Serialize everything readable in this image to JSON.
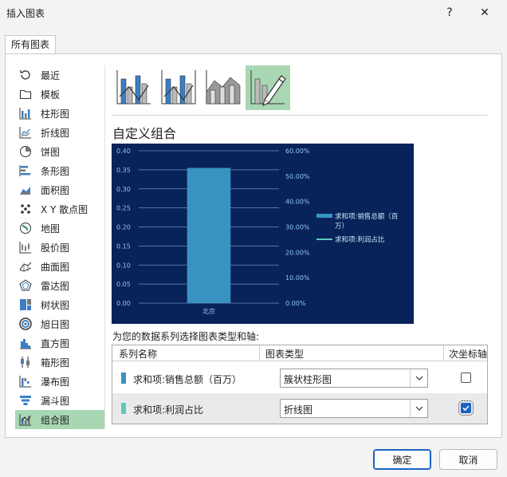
{
  "window": {
    "title": "插入图表",
    "help_label": "?",
    "close_label": "✕"
  },
  "tabs": [
    {
      "label": "所有图表"
    }
  ],
  "sidebar": {
    "items": [
      {
        "label": "最近",
        "icon": "recent-icon"
      },
      {
        "label": "模板",
        "icon": "folder-icon"
      },
      {
        "label": "柱形图",
        "icon": "column-chart-icon"
      },
      {
        "label": "折线图",
        "icon": "line-chart-icon"
      },
      {
        "label": "饼图",
        "icon": "pie-chart-icon"
      },
      {
        "label": "条形图",
        "icon": "bar-chart-icon"
      },
      {
        "label": "面积图",
        "icon": "area-chart-icon"
      },
      {
        "label": "X Y 散点图",
        "icon": "scatter-chart-icon"
      },
      {
        "label": "地图",
        "icon": "map-chart-icon"
      },
      {
        "label": "股价图",
        "icon": "stock-chart-icon"
      },
      {
        "label": "曲面图",
        "icon": "surface-chart-icon"
      },
      {
        "label": "雷达图",
        "icon": "radar-chart-icon"
      },
      {
        "label": "树状图",
        "icon": "treemap-chart-icon"
      },
      {
        "label": "旭日图",
        "icon": "sunburst-chart-icon"
      },
      {
        "label": "直方图",
        "icon": "histogram-chart-icon"
      },
      {
        "label": "箱形图",
        "icon": "box-whisker-chart-icon"
      },
      {
        "label": "瀑布图",
        "icon": "waterfall-chart-icon"
      },
      {
        "label": "漏斗图",
        "icon": "funnel-chart-icon"
      },
      {
        "label": "组合图",
        "icon": "combo-chart-icon",
        "selected": true
      }
    ]
  },
  "subtypes": [
    {
      "icon": "clustered-column-line-icon",
      "selected": false
    },
    {
      "icon": "clustered-column-line-secondary-icon",
      "selected": false
    },
    {
      "icon": "stacked-area-column-icon",
      "selected": false
    },
    {
      "icon": "custom-combination-icon",
      "selected": true
    }
  ],
  "section_title": "自定义组合",
  "colors": {
    "accent": "#1a63c2",
    "selection": "#a9d7b3",
    "chart_background": "#08235a",
    "bar_series": "#3993c2",
    "line_series": "#5fc9b6"
  },
  "chart_data": {
    "type": "bar",
    "categories": [
      "北京"
    ],
    "series": [
      {
        "name": "求和项:销售总额（百万）",
        "type": "bar",
        "axis": "primary",
        "values": [
          0.355
        ]
      },
      {
        "name": "求和项:利润占比",
        "type": "line",
        "axis": "secondary",
        "values": [
          0.0
        ]
      }
    ],
    "primary_ylim": [
      0,
      0.4
    ],
    "primary_ticks": [
      "0.00",
      "0.05",
      "0.10",
      "0.15",
      "0.20",
      "0.25",
      "0.30",
      "0.35",
      "0.40"
    ],
    "secondary_ylim": [
      0,
      0.6
    ],
    "secondary_ticks": [
      "0.00%",
      "10.00%",
      "20.00%",
      "30.00%",
      "40.00%",
      "50.00%",
      "60.00%"
    ],
    "grid": true,
    "legend": "right"
  },
  "assignment_label": "为您的数据系列选择图表类型和轴:",
  "grid": {
    "headers": {
      "name": "系列名称",
      "type": "图表类型",
      "secondary": "次坐标轴"
    },
    "rows": [
      {
        "name": "求和项:销售总额（百万）",
        "chart_type": "簇状柱形图",
        "secondary_axis": false,
        "color": "#3993c2"
      },
      {
        "name": "求和项:利润占比",
        "chart_type": "折线图",
        "secondary_axis": true,
        "color": "#5fc9b6"
      }
    ]
  },
  "buttons": {
    "ok": "确定",
    "cancel": "取消"
  }
}
